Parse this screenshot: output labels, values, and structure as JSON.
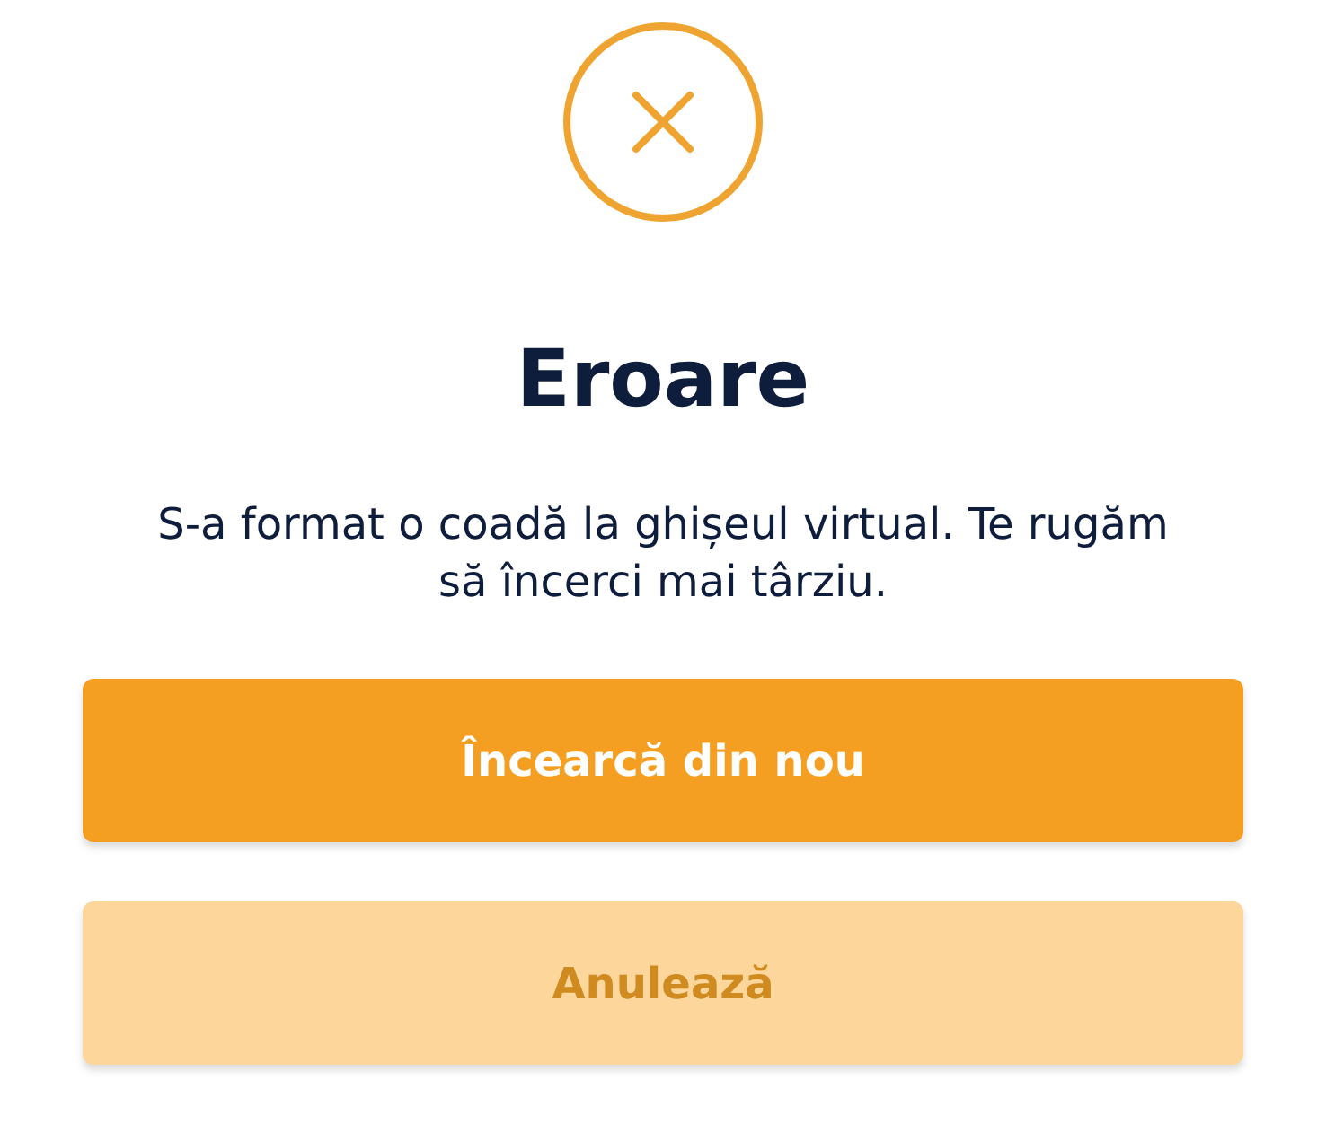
{
  "dialog": {
    "title": "Eroare",
    "message": "S-a format o coadă la ghișeul virtual. Te rugăm să încerci mai târziu."
  },
  "buttons": [
    {
      "label": "Încearcă din nou",
      "kind": "primary"
    },
    {
      "label": "Anulează",
      "kind": "secondary"
    }
  ]
}
